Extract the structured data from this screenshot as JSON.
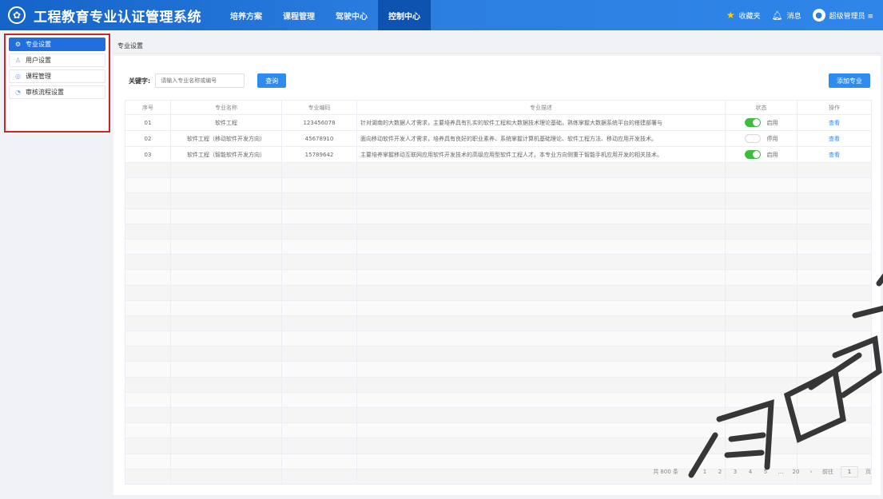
{
  "header": {
    "title": "工程教育专业认证管理系统",
    "nav": [
      "培养方案",
      "课程管理",
      "驾驶中心",
      "控制中心"
    ],
    "active_nav": 3,
    "favorites": "收藏夹",
    "messages": "消息",
    "user": "超级管理员 ≡"
  },
  "sidebar": {
    "items": [
      {
        "label": "专业设置",
        "icon": "gear-icon"
      },
      {
        "label": "用户设置",
        "icon": "user-icon"
      },
      {
        "label": "课程管理",
        "icon": "book-icon"
      },
      {
        "label": "审核流程设置",
        "icon": "flow-icon"
      }
    ]
  },
  "breadcrumb": "专业设置",
  "search": {
    "label": "关键字:",
    "placeholder": "请输入专业名称或编号",
    "button": "查询"
  },
  "add_button": "添加专业",
  "table": {
    "headers": [
      "序号",
      "专业名称",
      "专业编码",
      "专业描述",
      "状态",
      "操作"
    ],
    "rows": [
      {
        "no": "01",
        "name": "软件工程",
        "code": "123456078",
        "desc": "针对湖南的大数据人才需求，主要培养具有扎实的软件工程和大数据技术理论基础，熟练掌握大数据系统平台的搭建部署与",
        "status": "启用",
        "on": true,
        "action": "查看"
      },
      {
        "no": "02",
        "name": "软件工程（移动软件开发方向）",
        "code": "45678910",
        "desc": "面向移动软件开发人才需求，培养具有良好的职业素养、系统掌握计算机基础理论、软件工程方法、移动应用开发技术。",
        "status": "停用",
        "on": false,
        "action": "查看"
      },
      {
        "no": "03",
        "name": "软件工程（智能软件开发方向）",
        "code": "15789642",
        "desc": "主要培养掌握移动互联网应用软件开发技术的高级应用型软件工程人才。本专业方向侧重于智能手机应用开发的相关技术。",
        "status": "启用",
        "on": true,
        "action": "查看"
      }
    ]
  },
  "pagination": {
    "total": "共 800 条",
    "pages": [
      "‹",
      "1",
      "2",
      "3",
      "4",
      "5",
      "…",
      "20",
      "›"
    ],
    "goto": "前往",
    "page_input": "1",
    "page_suffix": "页"
  },
  "colors": {
    "header": "#1f6fe0",
    "accent": "#2e8cf0",
    "toggle_on": "#3dbd3d",
    "highlight_border": "#c62828"
  }
}
